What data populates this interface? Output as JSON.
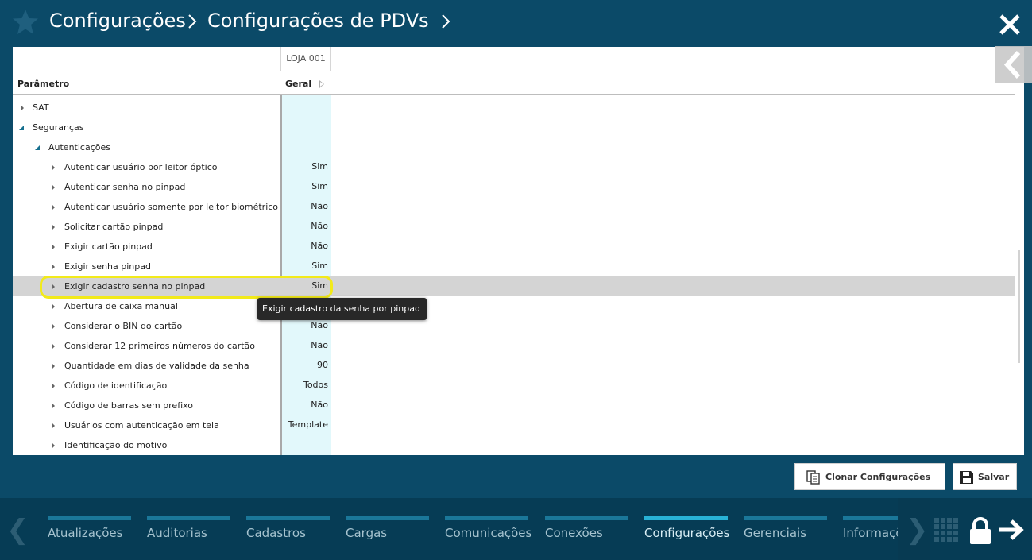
{
  "header": {
    "breadcrumb_1": "Configurações",
    "breadcrumb_2": "Configurações de PDVs"
  },
  "grid": {
    "store_column": "LOJA 001",
    "param_header": "Parâmetro",
    "value_header": "Geral",
    "rows": [
      {
        "label": "SAT",
        "value": ""
      },
      {
        "label": "Seguranças",
        "value": ""
      },
      {
        "label": "Autenticações",
        "value": ""
      },
      {
        "label": "Autenticar usuário por leitor óptico",
        "value": "Sim"
      },
      {
        "label": "Autenticar senha no pinpad",
        "value": "Sim"
      },
      {
        "label": "Autenticar usuário somente por leitor biométrico",
        "value": "Não"
      },
      {
        "label": "Solicitar cartão pinpad",
        "value": "Não"
      },
      {
        "label": "Exigir cartão pinpad",
        "value": "Não"
      },
      {
        "label": "Exigir senha pinpad",
        "value": "Sim"
      },
      {
        "label": "Exigir cadastro senha no pinpad",
        "value": "Sim"
      },
      {
        "label": "Abertura de caixa manual",
        "value": ""
      },
      {
        "label": "Considerar o BIN do cartão",
        "value": "Não"
      },
      {
        "label": "Considerar 12 primeiros números do cartão",
        "value": "Não"
      },
      {
        "label": "Quantidade em dias de validade da senha",
        "value": "90"
      },
      {
        "label": "Código de identificação",
        "value": "Todos"
      },
      {
        "label": "Código de barras sem prefixo",
        "value": "Não"
      },
      {
        "label": "Usuários com autenticação em tela",
        "value": "Template"
      },
      {
        "label": "Identificação do motivo",
        "value": ""
      }
    ],
    "tooltip": "Exigir cadastro da senha por pinpad"
  },
  "actions": {
    "clone_label": "Clonar Configurações",
    "save_label": "Salvar"
  },
  "footer": {
    "tabs": [
      "Atualizações",
      "Auditorias",
      "Cadastros",
      "Cargas",
      "Comunicações",
      "Conexões",
      "Configurações",
      "Gerenciais",
      "Informações"
    ],
    "active_tab": "Configurações"
  },
  "colors": {
    "background": "#0b4a68",
    "footer": "#063c55",
    "tab_bar": "#1a7799",
    "tab_bar_active": "#28b2d6",
    "value_column": "#e2f8fb",
    "selected_row": "#d4d4d4",
    "highlight": "#f2ea1a"
  },
  "icons": [
    "star-icon",
    "chevron-right-icon",
    "close-icon",
    "collapse-left-icon",
    "clone-icon",
    "save-icon",
    "grid-icon",
    "lock-icon",
    "arrow-right-icon"
  ]
}
